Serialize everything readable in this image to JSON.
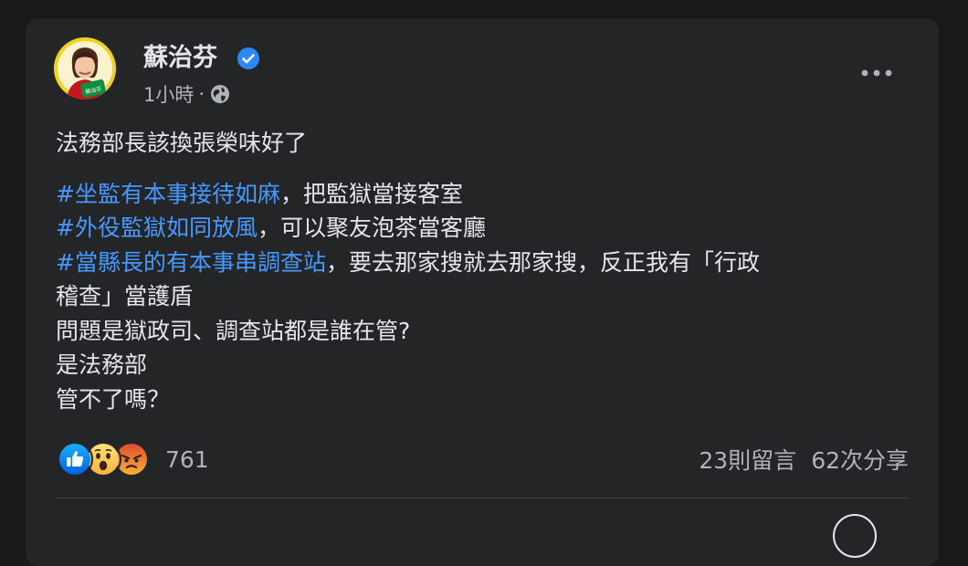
{
  "post": {
    "author": "蘇治芬",
    "time": "1小時",
    "dot": "·",
    "avatar_caption": "蘇治芬",
    "lines": [
      "法務部長該換張榮味好了",
      "，把監獄當接客室",
      "，可以聚友泡茶當客廳",
      "，要去那家搜就去那家搜，反正我有「行政",
      "稽查」當護盾",
      "問題是獄政司、調查站都是誰在管?",
      "是法務部",
      "管不了嗎？"
    ],
    "hashtags": [
      "#坐監有本事接待如麻",
      "#外役監獄如同放風",
      "#當縣長的有本事串調查站"
    ]
  },
  "footer": {
    "reaction_count": "761",
    "comments": "23則留言",
    "shares": "62次分享",
    "reactions": [
      "like-icon",
      "wow-icon",
      "angry-icon"
    ]
  },
  "colors": {
    "background": "#18191a",
    "card": "#242526",
    "text": "#e4e6eb",
    "secondary": "#b0b3b8",
    "link": "#4599ff",
    "verified": "#2d88ff"
  }
}
